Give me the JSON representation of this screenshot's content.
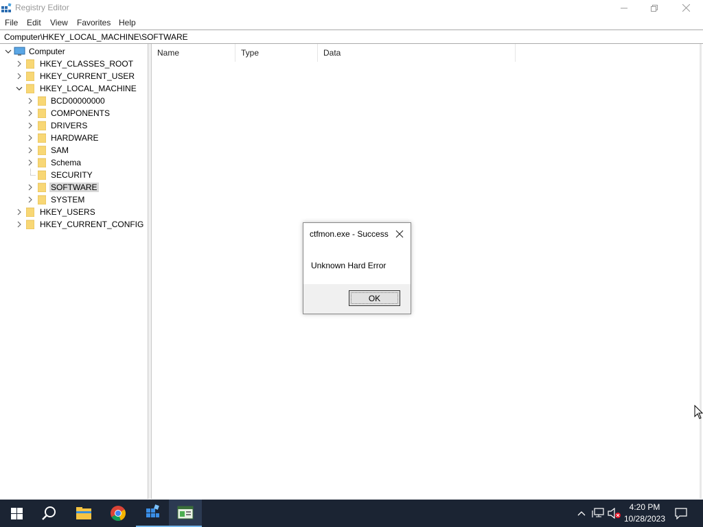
{
  "window": {
    "title": "Registry Editor"
  },
  "menu": [
    "File",
    "Edit",
    "View",
    "Favorites",
    "Help"
  ],
  "address": "Computer\\HKEY_LOCAL_MACHINE\\SOFTWARE",
  "tree": {
    "root": "Computer",
    "hives": [
      "HKEY_CLASSES_ROOT",
      "HKEY_CURRENT_USER",
      "HKEY_LOCAL_MACHINE",
      "HKEY_USERS",
      "HKEY_CURRENT_CONFIG"
    ],
    "hklm_children": [
      "BCD00000000",
      "COMPONENTS",
      "DRIVERS",
      "HARDWARE",
      "SAM",
      "Schema",
      "SECURITY",
      "SOFTWARE",
      "SYSTEM"
    ],
    "selected": "SOFTWARE"
  },
  "list": {
    "columns": [
      "Name",
      "Type",
      "Data"
    ]
  },
  "dialog": {
    "title": "ctfmon.exe - Success",
    "message": "Unknown Hard Error",
    "ok_label": "OK"
  },
  "taskbar": {
    "time": "4:20 PM",
    "date": "10/28/2023"
  },
  "colors": {
    "taskbar_bg": "#1b2433",
    "folder_yellow": "#f8d775",
    "accent_blue": "#76b9ed"
  }
}
